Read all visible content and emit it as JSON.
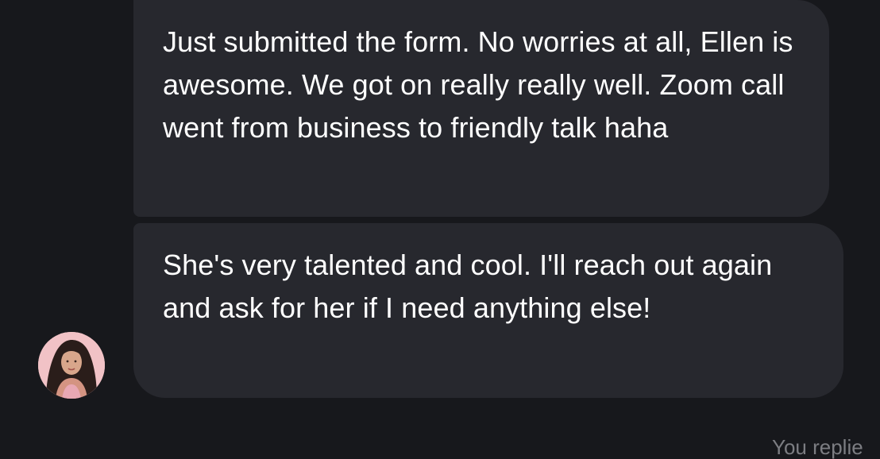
{
  "thread": {
    "messages": [
      {
        "text": "Just submitted the form. No worries at all, Ellen is awesome. We got on really really well. Zoom call went from business to friendly talk haha"
      },
      {
        "text": "She's very talented and cool. I'll reach out again and ask for her if I need anything else!"
      }
    ],
    "sender_avatar_icon": "user-avatar-photo",
    "footer_status": "You replie"
  },
  "colors": {
    "background": "#17181c",
    "bubble": "#27282e",
    "text": "#ffffff",
    "muted_text": "#7c7d82"
  }
}
